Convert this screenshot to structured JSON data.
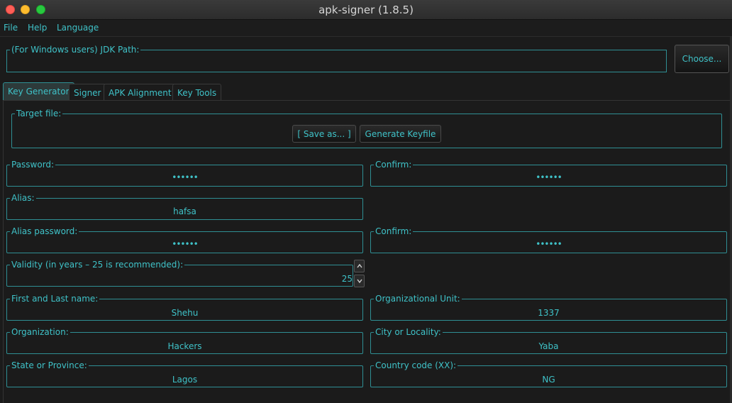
{
  "window": {
    "title": "apk-signer (1.8.5)"
  },
  "menu": {
    "items": [
      "File",
      "Help",
      "Language"
    ]
  },
  "jdk": {
    "label": "(For Windows users) JDK Path:",
    "value": "",
    "choose_label": "Choose..."
  },
  "tabs": [
    {
      "label": "Key Generator",
      "active": true
    },
    {
      "label": "Signer",
      "active": false
    },
    {
      "label": "APK Alignment",
      "active": false
    },
    {
      "label": "Key Tools",
      "active": false
    }
  ],
  "key_generator": {
    "target_file": {
      "label": "Target file:",
      "save_as_label": "[ Save as... ]",
      "generate_label": "Generate Keyfile"
    },
    "password": {
      "label": "Password:",
      "value": "••••••"
    },
    "password_confirm": {
      "label": "Confirm:",
      "value": "••••••"
    },
    "alias": {
      "label": "Alias:",
      "value": "hafsa"
    },
    "alias_password": {
      "label": "Alias password:",
      "value": "••••••"
    },
    "alias_password_confirm": {
      "label": "Confirm:",
      "value": "••••••"
    },
    "validity": {
      "label": "Validity (in years – 25 is recommended):",
      "value": "25"
    },
    "first_last_name": {
      "label": "First and Last name:",
      "value": "Shehu"
    },
    "org_unit": {
      "label": "Organizational Unit:",
      "value": "1337"
    },
    "organization": {
      "label": "Organization:",
      "value": "Hackers"
    },
    "city": {
      "label": "City or Locality:",
      "value": "Yaba"
    },
    "state": {
      "label": "State or Province:",
      "value": "Lagos"
    },
    "country": {
      "label": "Country code (XX):",
      "value": "NG"
    }
  },
  "colors": {
    "accent": "#3fc2c8",
    "border": "#2f8f94",
    "background": "#1b1b1b"
  }
}
